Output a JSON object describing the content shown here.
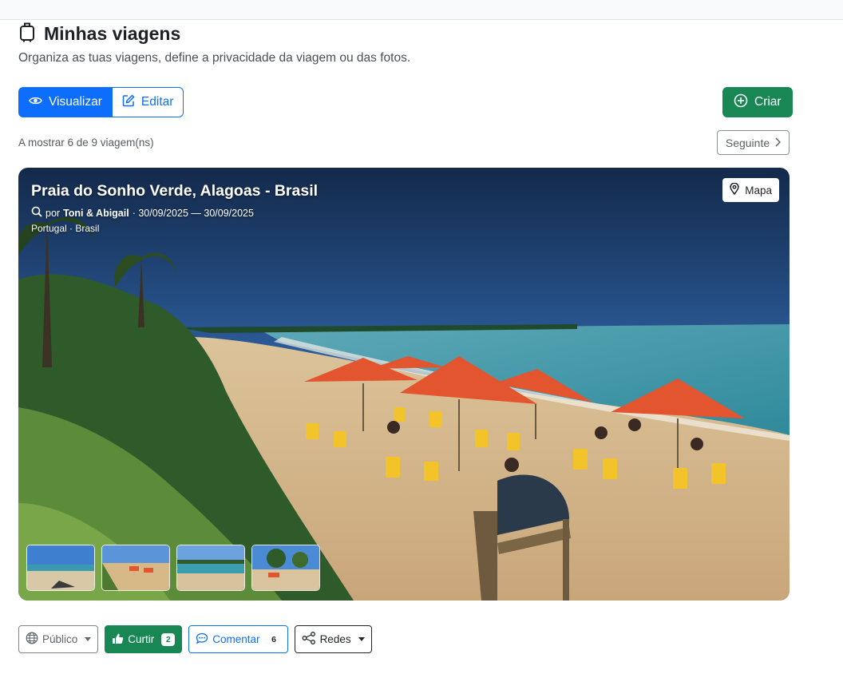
{
  "page": {
    "title": "Minhas viagens",
    "subtitle": "Organiza as tuas viagens, define a privacidade da viagem ou das fotos."
  },
  "toolbar": {
    "view_label": "Visualizar",
    "edit_label": "Editar",
    "create_label": "Criar"
  },
  "pagination": {
    "count_text": "A mostrar 6 de 9 viagem(ns)",
    "next_label": "Seguinte"
  },
  "trip": {
    "title": "Praia do Sonho Verde, Alagoas - Brasil",
    "by_label": "por",
    "authors": "Toni & Abigail",
    "dates": "· 30/09/2025 — 30/09/2025",
    "location": "Portugal · Brasil",
    "map_label": "Mapa"
  },
  "actions": {
    "privacy_label": "Público",
    "like_label": "Curtir",
    "like_count": "2",
    "comment_label": "Comentar",
    "comment_count": "6",
    "share_label": "Redes"
  },
  "colors": {
    "primary": "#0d6efd",
    "success": "#198754"
  },
  "icons": [
    "luggage-icon",
    "eye-icon",
    "edit-icon",
    "plus-circle-icon",
    "chevron-right-icon",
    "search-icon",
    "map-pin-icon",
    "globe-icon",
    "thumbs-up-icon",
    "comment-icon",
    "share-icon"
  ]
}
